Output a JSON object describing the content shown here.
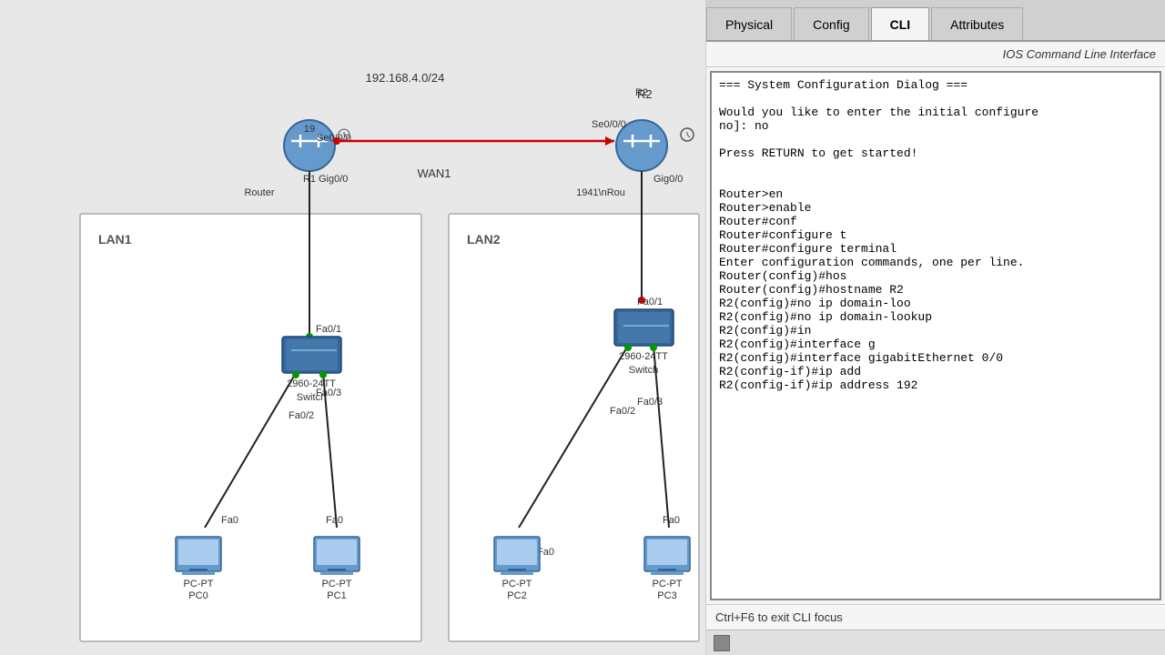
{
  "tabs": {
    "physical": "Physical",
    "config": "Config",
    "cli": "CLI",
    "attributes": "Attributes",
    "active": "CLI"
  },
  "cli_header": "IOS Command Line Interface",
  "cli_content": "=== System Configuration Dialog ===\n\nWould you like to enter the initial configure\nno]: no\n\nPress RETURN to get started!\n\n\nRouter>en\nRouter>enable\nRouter#conf\nRouter#configure t\nRouter#configure terminal\nEnter configuration commands, one per line.\nRouter(config)#hos\nRouter(config)#hostname R2\nR2(config)#no ip domain-loo\nR2(config)#no ip domain-lookup\nR2(config)#in\nR2(config)#interface g\nR2(config)#interface gigabitEthernet 0/0\nR2(config-if)#ip add\nR2(config-if)#ip address 192",
  "cli_footer": "Ctrl+F6 to exit CLI focus",
  "diagram": {
    "wan_label": "192.168.4.0/24",
    "wan_name": "WAN1",
    "r1_label": "R1",
    "r2_label": "R2",
    "r1_type": "1941\nRou",
    "r2_type": "1941\nRou",
    "r1_se": "Se0/0/0",
    "r2_se": "Se0/0/0",
    "r1_gig": "Gig0/0",
    "r2_gig": "Gig0/0",
    "lan1": "LAN1",
    "lan2": "LAN2",
    "sw1_fa1": "Fa0/1",
    "sw1_fa2": "Fa0/2",
    "sw1_fa3": "Fa0/3",
    "sw2_fa1": "Fa0/1",
    "sw2_fa2": "Fa0/2",
    "sw2_fa3": "Fa0/3",
    "pc0": "PC-PT\nPC0",
    "pc1": "PC-PT\nPC1",
    "pc2": "PC-PT\nPC2",
    "pc3": "PC-PT\nPC3"
  }
}
